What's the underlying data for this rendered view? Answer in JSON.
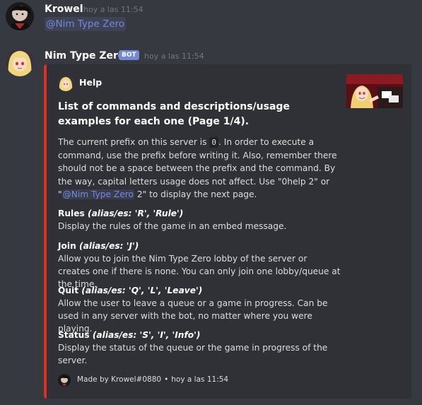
{
  "messages": {
    "first": {
      "author": "Krowel",
      "timestamp": "hoy a las 11:54",
      "mention": "@Nim Type Zero"
    },
    "second": {
      "author": "Nim Type Zero",
      "bot_tag": "BOT",
      "timestamp": "hoy a las 11:54"
    }
  },
  "embed": {
    "accent_color": "#d9302c",
    "author_name": "Help",
    "title": "List of commands and descriptions/usage examples for each one (Page 1/4).",
    "description": {
      "part1": "The current prefix on this server is ",
      "prefix_code": "0",
      "part2": ". In order to execute a command, use the prefix before writing it. Also, remember there should not be a space between the prefix and the command. By the way, capital letters usage does not affect. Use \"0help 2\" or \"",
      "mention": "@Nim Type Zero",
      "part3": " 2\" to display the next page."
    },
    "fields": [
      {
        "name": "Rules",
        "alias": "(alias/es: 'R', 'Rule')",
        "value": "Display the rules of the game in an embed message."
      },
      {
        "name": "Join",
        "alias": "(alias/es: 'J')",
        "value": "Allow you to join the Nim Type Zero lobby of the server or creates one if there is none. You can only join one lobby/queue at the time."
      },
      {
        "name": "Quit",
        "alias": "(alias/es: 'Q', 'L', 'Leave')",
        "value": "Allow the user to leave a queue or a game in progress. Can be used in any server with the bot, no matter where you were playing."
      },
      {
        "name": "Status",
        "alias": "(alias/es: 'S', 'I', 'Info')",
        "value": "Display the status of the queue or the game in progress of the server."
      }
    ],
    "footer": {
      "text": "Made by Krowel#0880",
      "separator": "•",
      "timestamp": "hoy a las 11:54"
    }
  },
  "colors": {
    "background": "#36393f",
    "embed_background": "#2f3136",
    "mention": "#7289da",
    "username": "#ffffff"
  }
}
